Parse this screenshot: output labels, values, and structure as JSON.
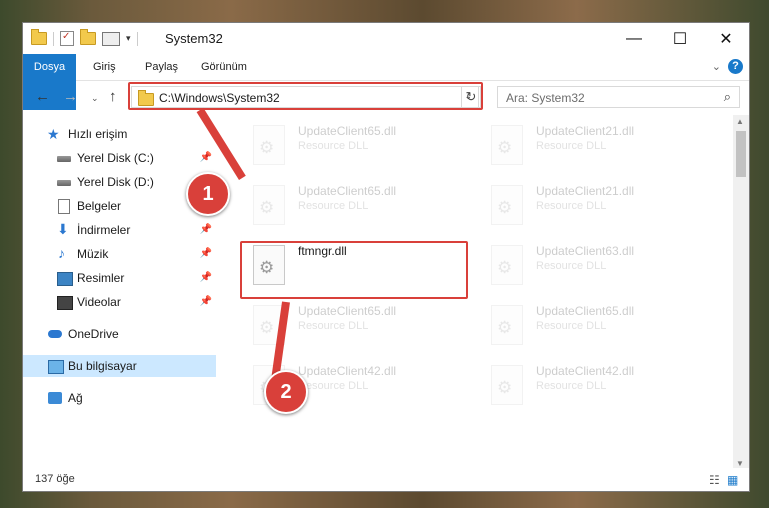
{
  "window": {
    "title": "System32",
    "minimize": "—",
    "maximize": "☐",
    "close": "✕"
  },
  "ribbon": {
    "tabs": [
      "Dosya",
      "Giriş",
      "Paylaş",
      "Görünüm"
    ],
    "expand": "⌄",
    "help": "?"
  },
  "nav": {
    "back": "←",
    "forward": "→",
    "recent": "⌄",
    "up": "↑",
    "address": "C:\\Windows\\System32",
    "address_dropdown": "⌄",
    "refresh": "↻",
    "search_placeholder": "Ara: System32",
    "search_icon": "⌕"
  },
  "sidebar": {
    "items": [
      {
        "label": "Hızlı erişim",
        "icon": "star-icon"
      },
      {
        "label": "Yerel Disk (C:)",
        "icon": "disk-icon",
        "pinned": true
      },
      {
        "label": "Yerel Disk (D:)",
        "icon": "disk-icon"
      },
      {
        "label": "Belgeler",
        "icon": "document-icon"
      },
      {
        "label": "İndirmeler",
        "icon": "download-icon",
        "pinned": true
      },
      {
        "label": "Müzik",
        "icon": "music-icon",
        "pinned": true
      },
      {
        "label": "Resimler",
        "icon": "pictures-icon",
        "pinned": true
      },
      {
        "label": "Videolar",
        "icon": "video-icon",
        "pinned": true
      },
      {
        "label": "OneDrive",
        "icon": "cloud-icon"
      },
      {
        "label": "Bu bilgisayar",
        "icon": "computer-icon",
        "selected": true
      },
      {
        "label": "Ağ",
        "icon": "network-icon"
      }
    ],
    "pin_glyph": "📌"
  },
  "files": {
    "left": [
      {
        "name": "UpdateClient65.dll",
        "desc": "Resource DLL",
        "faded": true
      },
      {
        "name": "UpdateClient65.dll",
        "desc": "Resource DLL",
        "faded": true
      },
      {
        "name": "ftmngr.dll",
        "desc": "",
        "faded": false
      },
      {
        "name": "UpdateClient65.dll",
        "desc": "Resource DLL",
        "faded": true
      },
      {
        "name": "UpdateClient42.dll",
        "desc": "Resource DLL",
        "faded": true
      }
    ],
    "right": [
      {
        "name": "UpdateClient21.dll",
        "desc": "Resource DLL",
        "faded": true
      },
      {
        "name": "UpdateClient21.dll",
        "desc": "Resource DLL",
        "faded": true
      },
      {
        "name": "UpdateClient63.dll",
        "desc": "Resource DLL",
        "faded": true
      },
      {
        "name": "UpdateClient65.dll",
        "desc": "Resource DLL",
        "faded": true
      },
      {
        "name": "UpdateClient42.dll",
        "desc": "Resource DLL",
        "faded": true
      }
    ]
  },
  "status": {
    "count": "137 öğe"
  },
  "annotations": {
    "step1": "1",
    "step2": "2",
    "color": "#d9403a"
  }
}
